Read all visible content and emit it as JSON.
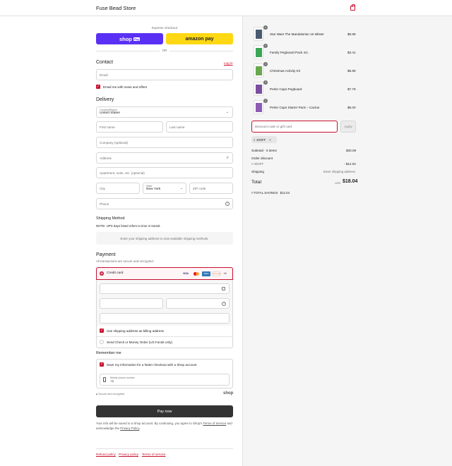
{
  "header": {
    "store_name": "Fuse Bead Store"
  },
  "express": {
    "title": "Express checkout",
    "shop_pay": "shop",
    "shop_pay_badge": "Pay",
    "amazon_pay": "amazon pay",
    "or": "OR"
  },
  "contact": {
    "title": "Contact",
    "login": "Log in",
    "email_placeholder": "Email",
    "newsletter_label": "Email me with news and offers"
  },
  "delivery": {
    "title": "Delivery",
    "country_label": "Country/Region",
    "country_value": "United States",
    "first_name": "First name",
    "last_name": "Last name",
    "company": "Company (optional)",
    "address": "Address",
    "apartment": "Apartment, suite, etc. (optional)",
    "city": "City",
    "state_label": "State",
    "state_value": "New York",
    "zip": "ZIP code",
    "phone": "Phone"
  },
  "shipping": {
    "title": "Shipping Method",
    "note": "NOTE: UPS days listed refers to time in transit.",
    "placeholder": "Enter your shipping address to view available shipping methods."
  },
  "payment": {
    "title": "Payment",
    "subtitle": "All transactions are secure and encrypted.",
    "credit_card": "Credit card",
    "card_brands": [
      "VISA",
      "MC",
      "AMEX",
      "DISCOVER"
    ],
    "more_brands": "+6",
    "use_shipping_label": "Use shipping address as billing address",
    "check_money_order": "Send Check or Money Order (US Funds only)"
  },
  "remember": {
    "title": "Remember me",
    "save_label": "Save my information for a faster checkout with a Shop account",
    "phone_label": "Mobile phone number",
    "phone_value": "+1",
    "secure_text": "Secure and encrypted",
    "shop_logo": "shop"
  },
  "pay_now": "Pay now",
  "legal": {
    "text_before": "Your info will be saved to a Shop account. By continuing, you agree to Shop's",
    "terms_link": "Terms of Service",
    "text_middle": "and acknowledge the",
    "privacy_link": "Privacy Policy",
    "text_end": "."
  },
  "footer_links": [
    "Refund policy",
    "Privacy policy",
    "Terms of service"
  ],
  "cart": {
    "items": [
      {
        "name": "Star Wars The Mandalorian 1K Blister",
        "price": "$6.89",
        "qty": "1",
        "color": "#4a5a70"
      },
      {
        "name": "Family Pegboard Pack 4ct.",
        "price": "$3.41",
        "qty": "1",
        "color": "#3aa655"
      },
      {
        "name": "Christmas Activity Kit",
        "price": "$5.99",
        "qty": "1",
        "color": "#6aa84f"
      },
      {
        "name": "Perler Caps Pegboard",
        "price": "$7.79",
        "qty": "1",
        "color": "#7a4fa0"
      },
      {
        "name": "Perler Caps Starter Pack – Cactus",
        "price": "$6.00",
        "qty": "1",
        "color": "#8e5bb5"
      }
    ],
    "discount_placeholder": "Discount code or gift card",
    "apply": "Apply",
    "applied_code": "40OFF",
    "subtotal_label": "Subtotal · 5 items",
    "subtotal_value": "$30.08",
    "order_discount_label": "Order discount",
    "discount_code": "40OFF",
    "discount_value": "- $12.04",
    "shipping_label": "Shipping",
    "shipping_value": "Enter shipping address",
    "total_label": "Total",
    "currency": "USD",
    "total_value": "$18.04",
    "savings_label": "TOTAL SAVINGS",
    "savings_value": "$12.04"
  },
  "colors": {
    "accent": "#c8102e",
    "shop_pay": "#5a31f4",
    "amazon": "#ffd814",
    "pay_button": "#333333"
  }
}
